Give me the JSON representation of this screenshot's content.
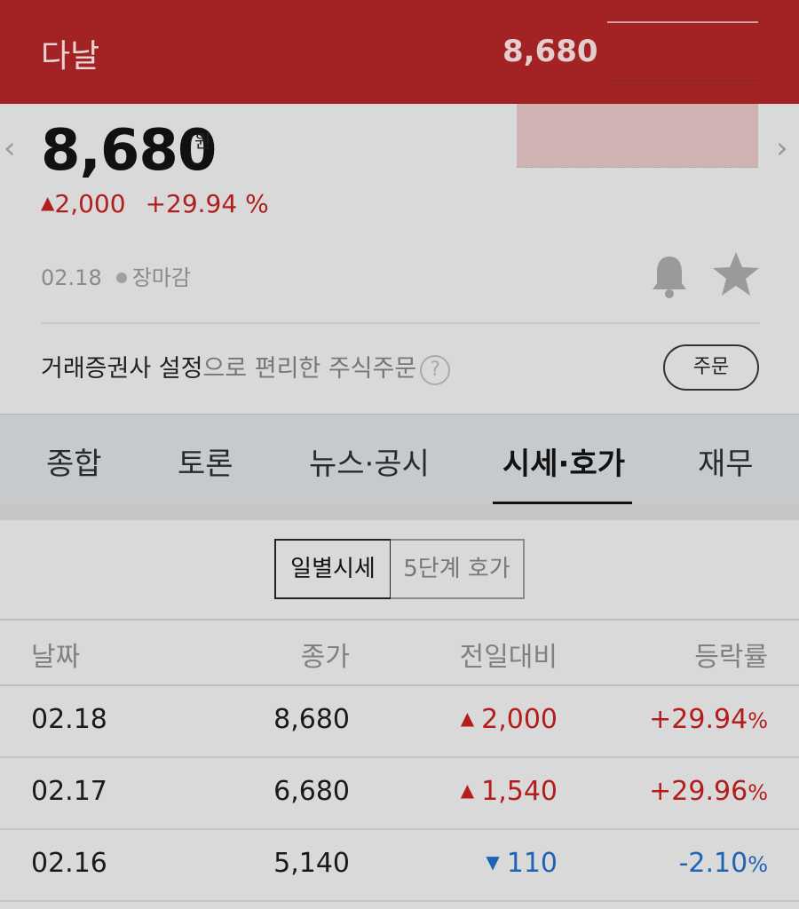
{
  "header": {
    "stock_name": "다날",
    "price": "8,680"
  },
  "summary": {
    "price": "8,680",
    "unit": "원",
    "change_arrow": "▲",
    "change_amount": "2,000",
    "change_rate": "+29.94 %",
    "date": "02.18",
    "market_status": "장마감",
    "nav_prev": "‹",
    "nav_next": "›"
  },
  "order": {
    "text_bold": "거래증권사 설정",
    "text_rest": "으로 편리한 주식주문",
    "help": "?",
    "button": "주문"
  },
  "tabs": [
    {
      "label": "종합"
    },
    {
      "label": "토론"
    },
    {
      "label": "뉴스·공시"
    },
    {
      "label": "시세·호가",
      "active": true
    },
    {
      "label": "재무"
    }
  ],
  "segment": {
    "daily": "일별시세",
    "five_level": "5단계 호가"
  },
  "table": {
    "headers": {
      "date": "날짜",
      "close": "종가",
      "diff": "전일대비",
      "rate": "등락률"
    },
    "rows": [
      {
        "date": "02.18",
        "close": "8,680",
        "arrow": "▲",
        "diff": "2,000",
        "rate": "+29.94",
        "dir": "up"
      },
      {
        "date": "02.17",
        "close": "6,680",
        "arrow": "▲",
        "diff": "1,540",
        "rate": "+29.96",
        "dir": "up"
      },
      {
        "date": "02.16",
        "close": "5,140",
        "arrow": "▼",
        "diff": "110",
        "rate": "-2.10",
        "dir": "down"
      }
    ],
    "pct_sign": "%"
  },
  "colors": {
    "header_bg": "#a32224",
    "up": "#b51c1c",
    "down": "#1f63b5"
  },
  "icons": [
    "bell-icon",
    "star-icon",
    "help-icon",
    "chevron-left-icon",
    "chevron-right-icon"
  ]
}
